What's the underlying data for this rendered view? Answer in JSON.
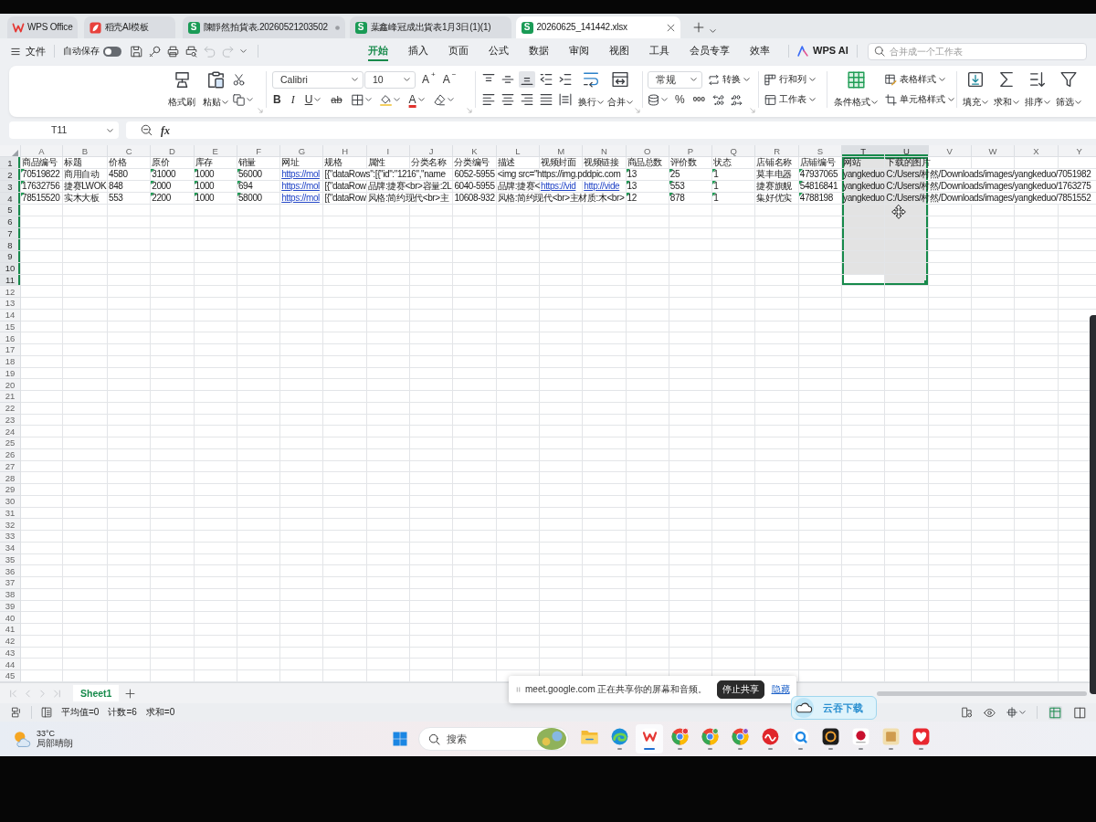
{
  "title_tabs": [
    {
      "kind": "app",
      "label": "WPS Office",
      "selected": false,
      "modified": false
    },
    {
      "kind": "template",
      "label": "稻壳AI模板",
      "selected": false,
      "modified": false
    },
    {
      "kind": "sheet",
      "badge": "S",
      "label": "陳靜然拍貨表.20260521203502",
      "selected": false,
      "modified": true
    },
    {
      "kind": "sheet",
      "badge": "S",
      "label": "葉鑫峰冠成出貨表1月3日(1)(1)",
      "selected": false,
      "modified": false
    },
    {
      "kind": "sheet",
      "badge": "S",
      "label": "20260625_141442.xlsx",
      "selected": true,
      "modified": false
    }
  ],
  "menu": {
    "file": "文件",
    "autosave": {
      "label": "自动保存",
      "on": false
    },
    "quick_access": [
      {
        "disabled": false
      },
      {
        "disabled": false
      },
      {
        "disabled": false
      },
      {
        "disabled": false
      },
      {
        "disabled": true
      },
      {
        "disabled": true
      }
    ],
    "tabs": [
      {
        "label": "开始",
        "selected": true
      },
      {
        "label": "插入",
        "selected": false
      },
      {
        "label": "页面",
        "selected": false
      },
      {
        "label": "公式",
        "selected": false
      },
      {
        "label": "数据",
        "selected": false
      },
      {
        "label": "审阅",
        "selected": false
      },
      {
        "label": "视图",
        "selected": false
      },
      {
        "label": "工具",
        "selected": false
      },
      {
        "label": "会员专享",
        "selected": false
      },
      {
        "label": "效率",
        "selected": false
      }
    ],
    "ai": "WPS AI",
    "search": {
      "placeholder": "合并成一个工作表"
    }
  },
  "ribbon": {
    "format_painter": "格式刷",
    "paste": "粘贴",
    "font_name": "Calibri",
    "font_size": "10",
    "grow_font": "A$^{+}$",
    "shrink_font": "A$^{−}$",
    "bold": "B",
    "italic": "I",
    "underline": "U",
    "strikethrough": "ab",
    "font_color": "A",
    "vertical_align": [
      {
        "selected": false
      },
      {
        "selected": false
      },
      {
        "selected": true
      }
    ],
    "wrap": "换行",
    "merge": "合并",
    "number_format": "常规",
    "convert": "转换",
    "percent": "%",
    "thousands": "000",
    "rows_columns": "行和列",
    "worksheet": "工作表",
    "conditional_format": "条件格式",
    "table_style": "表格样式",
    "cell_style": "单元格样式",
    "fill": "填充",
    "sum": "求和",
    "sort": "排序",
    "filter": "筛选"
  },
  "formula_bar": {
    "name_box": "T11",
    "fx": "fx"
  },
  "sheet": {
    "columns": [
      {
        "label": "A",
        "selected": false
      },
      {
        "label": "B",
        "selected": false
      },
      {
        "label": "C",
        "selected": false
      },
      {
        "label": "D",
        "selected": false
      },
      {
        "label": "E",
        "selected": false
      },
      {
        "label": "F",
        "selected": false
      },
      {
        "label": "G",
        "selected": false
      },
      {
        "label": "H",
        "selected": false
      },
      {
        "label": "I",
        "selected": false
      },
      {
        "label": "J",
        "selected": false
      },
      {
        "label": "K",
        "selected": false
      },
      {
        "label": "L",
        "selected": false
      },
      {
        "label": "M",
        "selected": false
      },
      {
        "label": "N",
        "selected": false
      },
      {
        "label": "O",
        "selected": false
      },
      {
        "label": "P",
        "selected": false
      },
      {
        "label": "Q",
        "selected": false
      },
      {
        "label": "R",
        "selected": false
      },
      {
        "label": "S",
        "selected": false
      },
      {
        "label": "T",
        "selected": true
      },
      {
        "label": "U",
        "selected": true
      },
      {
        "label": "V",
        "selected": false
      },
      {
        "label": "W",
        "selected": false
      },
      {
        "label": "X",
        "selected": false
      },
      {
        "label": "Y",
        "selected": false
      }
    ],
    "rows": [
      {
        "number": "1",
        "selected": true,
        "cells": [
          {
            "text": "商品编号",
            "kind": "text",
            "flagged": false
          },
          {
            "text": "标题",
            "kind": "text",
            "flagged": false
          },
          {
            "text": "价格",
            "kind": "text",
            "flagged": false
          },
          {
            "text": "原价",
            "kind": "text",
            "flagged": false
          },
          {
            "text": "库存",
            "kind": "text",
            "flagged": false
          },
          {
            "text": "销量",
            "kind": "text",
            "flagged": false
          },
          {
            "text": "网址",
            "kind": "text",
            "flagged": false
          },
          {
            "text": "规格",
            "kind": "text",
            "flagged": false
          },
          {
            "text": "属性",
            "kind": "text",
            "flagged": false
          },
          {
            "text": "分类名称",
            "kind": "text",
            "flagged": false
          },
          {
            "text": "分类编号",
            "kind": "text",
            "flagged": false
          },
          {
            "text": "描述",
            "kind": "text",
            "flagged": false
          },
          {
            "text": "视频封面",
            "kind": "text",
            "flagged": false
          },
          {
            "text": "视频链接",
            "kind": "text",
            "flagged": false
          },
          {
            "text": "商品总数",
            "kind": "text",
            "flagged": false
          },
          {
            "text": "评价数",
            "kind": "text",
            "flagged": false
          },
          {
            "text": "状态",
            "kind": "text",
            "flagged": false
          },
          {
            "text": "店铺名称",
            "kind": "text",
            "flagged": false
          },
          {
            "text": "店铺编号",
            "kind": "text",
            "flagged": false
          },
          {
            "text": "网站",
            "kind": "text",
            "flagged": false
          },
          {
            "text": "下载的图片",
            "kind": "text",
            "flagged": false
          }
        ]
      },
      {
        "number": "2",
        "selected": true,
        "cells": [
          {
            "text": "70519822",
            "kind": "text",
            "flagged": true
          },
          {
            "text": "商用自动",
            "kind": "text",
            "flagged": false
          },
          {
            "text": "4580",
            "kind": "text",
            "flagged": false
          },
          {
            "text": "31000",
            "kind": "text",
            "flagged": true
          },
          {
            "text": "1000",
            "kind": "text",
            "flagged": true
          },
          {
            "text": "56000",
            "kind": "text",
            "flagged": true
          },
          {
            "text": "https://mol",
            "kind": "link",
            "flagged": false
          },
          {
            "text": "[{\"dataRows\":[{\"id\":\"1216\",\"name",
            "kind": "text",
            "flagged": false
          },
          null,
          null,
          {
            "text": "6052-5955",
            "kind": "text",
            "flagged": false
          },
          {
            "text": "<img src=\"https://img.pddpic.com",
            "kind": "text",
            "flagged": false
          },
          null,
          null,
          {
            "text": "13",
            "kind": "text",
            "flagged": true
          },
          {
            "text": "25",
            "kind": "text",
            "flagged": true
          },
          {
            "text": "1",
            "kind": "text",
            "flagged": true
          },
          {
            "text": "莫丰电器",
            "kind": "text",
            "flagged": false
          },
          {
            "text": "47937065",
            "kind": "text",
            "flagged": true
          },
          {
            "text": "yangkeduo",
            "kind": "text",
            "flagged": false
          },
          {
            "text": "C:/Users/村然/Downloads/images/yangkeduo/7051982",
            "kind": "text",
            "flagged": false
          }
        ]
      },
      {
        "number": "3",
        "selected": true,
        "cells": [
          {
            "text": "17632756",
            "kind": "text",
            "flagged": true
          },
          {
            "text": "捷赛LWOK",
            "kind": "text",
            "flagged": false
          },
          {
            "text": "848",
            "kind": "text",
            "flagged": false
          },
          {
            "text": "2000",
            "kind": "text",
            "flagged": true
          },
          {
            "text": "1000",
            "kind": "text",
            "flagged": true
          },
          {
            "text": "694",
            "kind": "text",
            "flagged": true
          },
          {
            "text": "https://mol",
            "kind": "link",
            "flagged": false
          },
          {
            "text": "[{\"dataRow",
            "kind": "text",
            "flagged": false
          },
          {
            "text": "品牌:捷赛<br>容量:2L",
            "kind": "text",
            "flagged": false
          },
          null,
          {
            "text": "6040-5955",
            "kind": "text",
            "flagged": false
          },
          {
            "text": "品牌:捷赛<",
            "kind": "text",
            "flagged": false
          },
          {
            "text": "https://vid",
            "kind": "link",
            "flagged": false
          },
          {
            "text": "http://vide",
            "kind": "link",
            "flagged": false
          },
          {
            "text": "13",
            "kind": "text",
            "flagged": true
          },
          {
            "text": "553",
            "kind": "text",
            "flagged": true
          },
          {
            "text": "1",
            "kind": "text",
            "flagged": true
          },
          {
            "text": "捷赛旗舰",
            "kind": "text",
            "flagged": false
          },
          {
            "text": "54816841",
            "kind": "text",
            "flagged": true
          },
          {
            "text": "yangkeduo",
            "kind": "text",
            "flagged": false
          },
          {
            "text": "C:/Users/村然/Downloads/images/yangkeduo/1763275",
            "kind": "text",
            "flagged": false
          }
        ]
      },
      {
        "number": "4",
        "selected": true,
        "cells": [
          {
            "text": "78515520",
            "kind": "text",
            "flagged": true
          },
          {
            "text": "实木大板",
            "kind": "text",
            "flagged": false
          },
          {
            "text": "553",
            "kind": "text",
            "flagged": false
          },
          {
            "text": "2200",
            "kind": "text",
            "flagged": true
          },
          {
            "text": "1000",
            "kind": "text",
            "flagged": true
          },
          {
            "text": "58000",
            "kind": "text",
            "flagged": true
          },
          {
            "text": "https://mol",
            "kind": "link",
            "flagged": false
          },
          {
            "text": "[{\"dataRow",
            "kind": "text",
            "flagged": false
          },
          {
            "text": "风格:简约现代<br>主",
            "kind": "text",
            "flagged": false
          },
          null,
          {
            "text": "10608-932",
            "kind": "text",
            "flagged": false
          },
          {
            "text": "风格:简约现代<br>主材质:木<br>",
            "kind": "text",
            "flagged": false
          },
          null,
          null,
          {
            "text": "12",
            "kind": "text",
            "flagged": true
          },
          {
            "text": "878",
            "kind": "text",
            "flagged": true
          },
          {
            "text": "1",
            "kind": "text",
            "flagged": true
          },
          {
            "text": "集好优实",
            "kind": "text",
            "flagged": false
          },
          {
            "text": "4788198",
            "kind": "text",
            "flagged": true
          },
          {
            "text": "yangkeduo",
            "kind": "text",
            "flagged": false
          },
          {
            "text": "C:/Users/村然/Downloads/images/yangkeduo/7851552",
            "kind": "text",
            "flagged": false
          }
        ]
      },
      {
        "number": "5",
        "selected": true
      },
      {
        "number": "6",
        "selected": true
      },
      {
        "number": "7",
        "selected": true
      },
      {
        "number": "8",
        "selected": true
      },
      {
        "number": "9",
        "selected": true
      },
      {
        "number": "10",
        "selected": true
      },
      {
        "number": "11",
        "selected": true
      },
      {
        "number": "12",
        "selected": false
      },
      {
        "number": "13",
        "selected": false
      },
      {
        "number": "14",
        "selected": false
      },
      {
        "number": "15",
        "selected": false
      },
      {
        "number": "16",
        "selected": false
      },
      {
        "number": "17",
        "selected": false
      },
      {
        "number": "18",
        "selected": false
      },
      {
        "number": "19",
        "selected": false
      },
      {
        "number": "20",
        "selected": false
      },
      {
        "number": "21",
        "selected": false
      },
      {
        "number": "22",
        "selected": false
      },
      {
        "number": "23",
        "selected": false
      },
      {
        "number": "24",
        "selected": false
      },
      {
        "number": "25",
        "selected": false
      },
      {
        "number": "26",
        "selected": false
      },
      {
        "number": "27",
        "selected": false
      },
      {
        "number": "28",
        "selected": false
      },
      {
        "number": "29",
        "selected": false
      },
      {
        "number": "30",
        "selected": false
      },
      {
        "number": "31",
        "selected": false
      },
      {
        "number": "32",
        "selected": false
      },
      {
        "number": "33",
        "selected": false
      },
      {
        "number": "34",
        "selected": false
      },
      {
        "number": "35",
        "selected": false
      },
      {
        "number": "36",
        "selected": false
      },
      {
        "number": "37",
        "selected": false
      },
      {
        "number": "38",
        "selected": false
      },
      {
        "number": "39",
        "selected": false
      },
      {
        "number": "40",
        "selected": false
      },
      {
        "number": "41",
        "selected": false
      },
      {
        "number": "42",
        "selected": false
      },
      {
        "number": "43",
        "selected": false
      },
      {
        "number": "44",
        "selected": false
      },
      {
        "number": "45",
        "selected": false
      }
    ]
  },
  "sheet_tabs": [
    {
      "label": "Sheet1",
      "selected": true
    }
  ],
  "status_bar": {
    "stats": [
      "平均值=0",
      "计数=6",
      "求和=0"
    ],
    "views": [
      {
        "selected": true
      },
      {
        "selected": false
      }
    ]
  },
  "share_notice": {
    "message": "meet.google.com 正在共享你的屏幕和音频。",
    "stop": "停止共享",
    "hide": "隐藏"
  },
  "download_widget": {
    "label": "云吞下载"
  },
  "taskbar": {
    "weather": {
      "temperature": "33°C",
      "condition": "局部晴朗"
    },
    "search": {
      "placeholder": "搜索"
    },
    "apps": [
      {
        "running": false,
        "active": false
      },
      {
        "running": true,
        "active": false
      },
      {
        "running": true,
        "active": true
      },
      {
        "running": true,
        "active": false
      },
      {
        "running": true,
        "active": false
      },
      {
        "running": true,
        "active": false
      },
      {
        "running": true,
        "active": false
      },
      {
        "running": true,
        "active": false
      },
      {
        "running": true,
        "active": false
      },
      {
        "running": true,
        "active": false
      },
      {
        "running": true,
        "active": false
      },
      {
        "running": true,
        "active": false
      }
    ]
  }
}
